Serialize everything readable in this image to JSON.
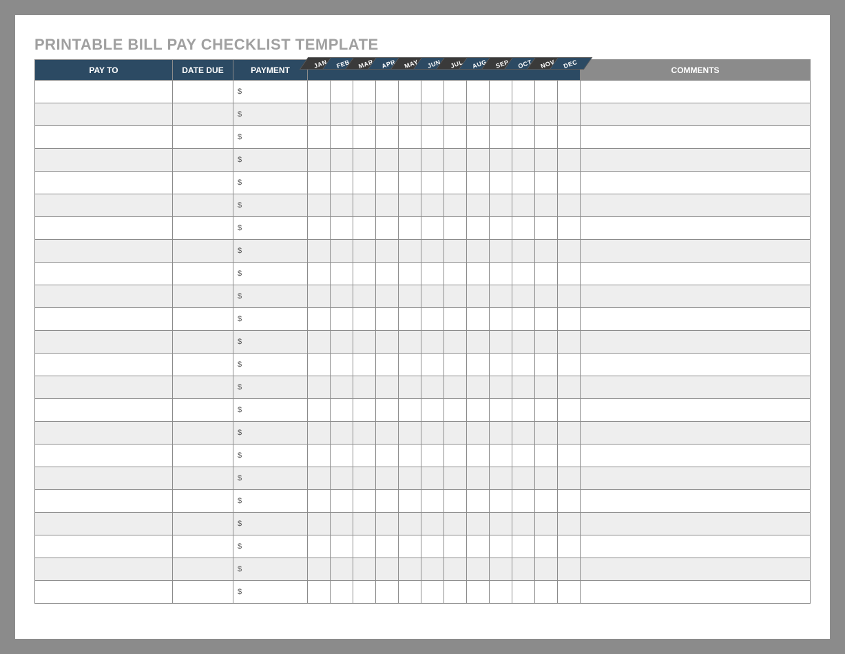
{
  "title": "PRINTABLE BILL PAY CHECKLIST TEMPLATE",
  "headers": {
    "pay_to": "PAY TO",
    "date_due": "DATE DUE",
    "payment": "PAYMENT",
    "comments": "COMMENTS"
  },
  "months": [
    "JAN",
    "FEB",
    "MAR",
    "APR",
    "MAY",
    "JUN",
    "JUL",
    "AUG",
    "SEP",
    "OCT",
    "NOV",
    "DEC"
  ],
  "row_count": 23,
  "payment_prefix": "$",
  "month_tab_colors": [
    "dark",
    "blue",
    "dark",
    "blue",
    "dark",
    "blue",
    "dark",
    "blue",
    "dark",
    "blue",
    "dark",
    "blue"
  ]
}
